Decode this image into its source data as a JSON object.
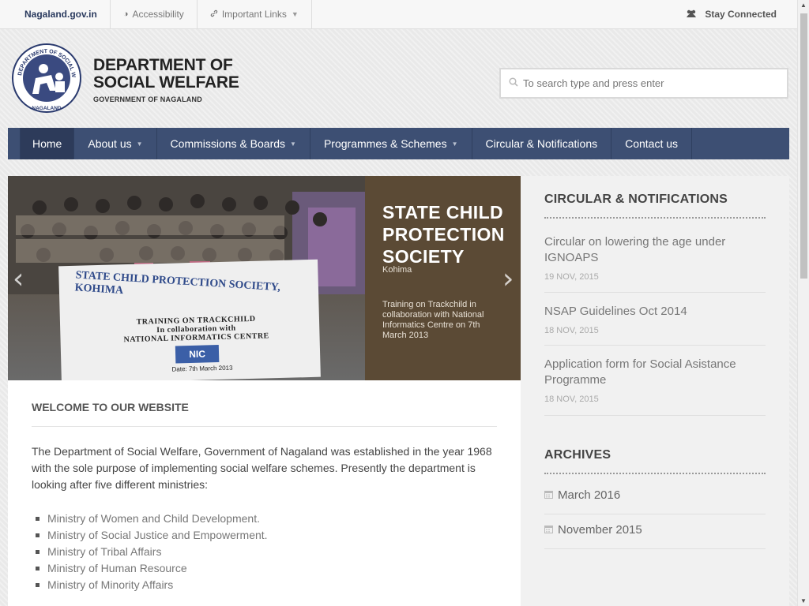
{
  "topbar": {
    "site_link": "Nagaland.gov.in",
    "accessibility": "Accessibility",
    "important_links": "Important Links",
    "stay_connected": "Stay Connected"
  },
  "header": {
    "brand_line1": "DEPARTMENT OF",
    "brand_line2": "SOCIAL WELFARE",
    "brand_line3": "GOVERNMENT OF NAGALAND",
    "logo_text": "DEPARTMENT OF SOCIAL WELFARE NAGALAND"
  },
  "search": {
    "placeholder": "To search type and press enter"
  },
  "nav": {
    "items": [
      {
        "label": "Home",
        "active": true,
        "dropdown": false
      },
      {
        "label": "About us",
        "dropdown": true
      },
      {
        "label": "Commissions & Boards",
        "dropdown": true
      },
      {
        "label": "Programmes & Schemes",
        "dropdown": true
      },
      {
        "label": "Circular & Notifications",
        "dropdown": false
      },
      {
        "label": "Contact us",
        "dropdown": false
      }
    ]
  },
  "slider": {
    "title": "STATE CHILD PROTECTION SOCIETY",
    "subtitle": "Kohima",
    "description": "Training on Trackchild in collaboration with National Informatics Centre on 7th March 2013",
    "banner_line1": "STATE CHILD PROTECTION SOCIETY, KOHIMA",
    "banner_line2": "TRAINING ON TRACKCHILD",
    "banner_line3": "In collaboration with",
    "banner_line4": "NATIONAL INFORMATICS CENTRE",
    "banner_logo": "NIC",
    "banner_date": "Date: 7th March 2013"
  },
  "welcome": {
    "heading": "WELCOME TO OUR WEBSITE",
    "paragraph": "The Department of Social Welfare, Government of Nagaland was established in the year 1968 with the sole purpose of implementing social welfare schemes. Presently the department is looking after five different ministries:",
    "ministries": [
      "Ministry of Women and Child Development.",
      "Ministry of Social Justice and Empowerment.",
      "Ministry of Tribal Affairs",
      "Ministry of Human Resource",
      "Ministry of Minority Affairs"
    ]
  },
  "sidebar": {
    "circulars_heading": "CIRCULAR & NOTIFICATIONS",
    "notices": [
      {
        "title": "Circular on lowering the age under IGNOAPS",
        "date": "19 NOV, 2015"
      },
      {
        "title": "NSAP Guidelines Oct 2014",
        "date": "18 NOV, 2015"
      },
      {
        "title": "Application form for Social Asistance Programme",
        "date": "18 NOV, 2015"
      }
    ],
    "archives_heading": "ARCHIVES",
    "archives": [
      "March 2016",
      "November 2015"
    ]
  },
  "colors": {
    "nav_bg": "#3d4f73",
    "nav_active": "#2d3b5a",
    "slide_caption_bg": "#5b4a35",
    "brand_link": "#2a3a5e"
  }
}
